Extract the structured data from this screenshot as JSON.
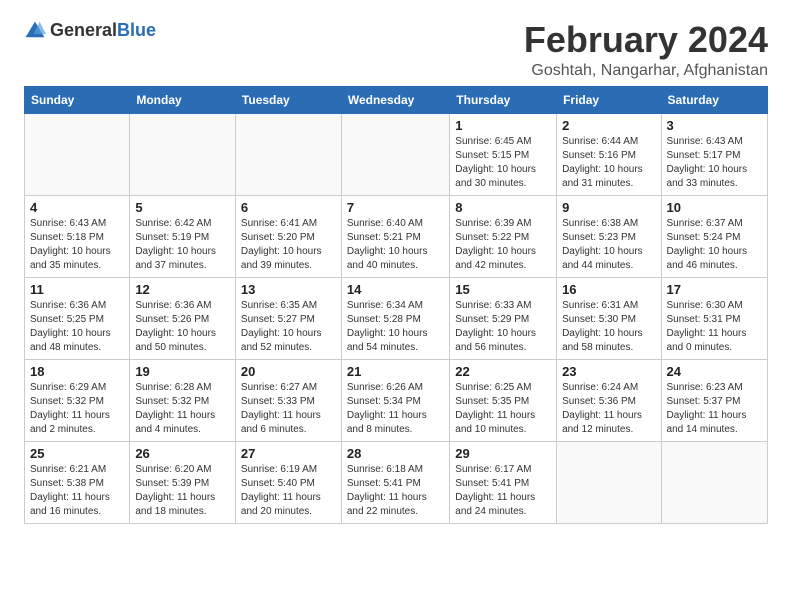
{
  "logo": {
    "general": "General",
    "blue": "Blue"
  },
  "title": "February 2024",
  "subtitle": "Goshtah, Nangarhar, Afghanistan",
  "days_of_week": [
    "Sunday",
    "Monday",
    "Tuesday",
    "Wednesday",
    "Thursday",
    "Friday",
    "Saturday"
  ],
  "weeks": [
    [
      {
        "day": "",
        "detail": "",
        "empty": true
      },
      {
        "day": "",
        "detail": "",
        "empty": true
      },
      {
        "day": "",
        "detail": "",
        "empty": true
      },
      {
        "day": "",
        "detail": "",
        "empty": true
      },
      {
        "day": "1",
        "detail": "Sunrise: 6:45 AM\nSunset: 5:15 PM\nDaylight: 10 hours\nand 30 minutes."
      },
      {
        "day": "2",
        "detail": "Sunrise: 6:44 AM\nSunset: 5:16 PM\nDaylight: 10 hours\nand 31 minutes."
      },
      {
        "day": "3",
        "detail": "Sunrise: 6:43 AM\nSunset: 5:17 PM\nDaylight: 10 hours\nand 33 minutes."
      }
    ],
    [
      {
        "day": "4",
        "detail": "Sunrise: 6:43 AM\nSunset: 5:18 PM\nDaylight: 10 hours\nand 35 minutes."
      },
      {
        "day": "5",
        "detail": "Sunrise: 6:42 AM\nSunset: 5:19 PM\nDaylight: 10 hours\nand 37 minutes."
      },
      {
        "day": "6",
        "detail": "Sunrise: 6:41 AM\nSunset: 5:20 PM\nDaylight: 10 hours\nand 39 minutes."
      },
      {
        "day": "7",
        "detail": "Sunrise: 6:40 AM\nSunset: 5:21 PM\nDaylight: 10 hours\nand 40 minutes."
      },
      {
        "day": "8",
        "detail": "Sunrise: 6:39 AM\nSunset: 5:22 PM\nDaylight: 10 hours\nand 42 minutes."
      },
      {
        "day": "9",
        "detail": "Sunrise: 6:38 AM\nSunset: 5:23 PM\nDaylight: 10 hours\nand 44 minutes."
      },
      {
        "day": "10",
        "detail": "Sunrise: 6:37 AM\nSunset: 5:24 PM\nDaylight: 10 hours\nand 46 minutes."
      }
    ],
    [
      {
        "day": "11",
        "detail": "Sunrise: 6:36 AM\nSunset: 5:25 PM\nDaylight: 10 hours\nand 48 minutes."
      },
      {
        "day": "12",
        "detail": "Sunrise: 6:36 AM\nSunset: 5:26 PM\nDaylight: 10 hours\nand 50 minutes."
      },
      {
        "day": "13",
        "detail": "Sunrise: 6:35 AM\nSunset: 5:27 PM\nDaylight: 10 hours\nand 52 minutes."
      },
      {
        "day": "14",
        "detail": "Sunrise: 6:34 AM\nSunset: 5:28 PM\nDaylight: 10 hours\nand 54 minutes."
      },
      {
        "day": "15",
        "detail": "Sunrise: 6:33 AM\nSunset: 5:29 PM\nDaylight: 10 hours\nand 56 minutes."
      },
      {
        "day": "16",
        "detail": "Sunrise: 6:31 AM\nSunset: 5:30 PM\nDaylight: 10 hours\nand 58 minutes."
      },
      {
        "day": "17",
        "detail": "Sunrise: 6:30 AM\nSunset: 5:31 PM\nDaylight: 11 hours\nand 0 minutes."
      }
    ],
    [
      {
        "day": "18",
        "detail": "Sunrise: 6:29 AM\nSunset: 5:32 PM\nDaylight: 11 hours\nand 2 minutes."
      },
      {
        "day": "19",
        "detail": "Sunrise: 6:28 AM\nSunset: 5:32 PM\nDaylight: 11 hours\nand 4 minutes."
      },
      {
        "day": "20",
        "detail": "Sunrise: 6:27 AM\nSunset: 5:33 PM\nDaylight: 11 hours\nand 6 minutes."
      },
      {
        "day": "21",
        "detail": "Sunrise: 6:26 AM\nSunset: 5:34 PM\nDaylight: 11 hours\nand 8 minutes."
      },
      {
        "day": "22",
        "detail": "Sunrise: 6:25 AM\nSunset: 5:35 PM\nDaylight: 11 hours\nand 10 minutes."
      },
      {
        "day": "23",
        "detail": "Sunrise: 6:24 AM\nSunset: 5:36 PM\nDaylight: 11 hours\nand 12 minutes."
      },
      {
        "day": "24",
        "detail": "Sunrise: 6:23 AM\nSunset: 5:37 PM\nDaylight: 11 hours\nand 14 minutes."
      }
    ],
    [
      {
        "day": "25",
        "detail": "Sunrise: 6:21 AM\nSunset: 5:38 PM\nDaylight: 11 hours\nand 16 minutes."
      },
      {
        "day": "26",
        "detail": "Sunrise: 6:20 AM\nSunset: 5:39 PM\nDaylight: 11 hours\nand 18 minutes."
      },
      {
        "day": "27",
        "detail": "Sunrise: 6:19 AM\nSunset: 5:40 PM\nDaylight: 11 hours\nand 20 minutes."
      },
      {
        "day": "28",
        "detail": "Sunrise: 6:18 AM\nSunset: 5:41 PM\nDaylight: 11 hours\nand 22 minutes."
      },
      {
        "day": "29",
        "detail": "Sunrise: 6:17 AM\nSunset: 5:41 PM\nDaylight: 11 hours\nand 24 minutes."
      },
      {
        "day": "",
        "detail": "",
        "empty": true
      },
      {
        "day": "",
        "detail": "",
        "empty": true
      }
    ]
  ]
}
